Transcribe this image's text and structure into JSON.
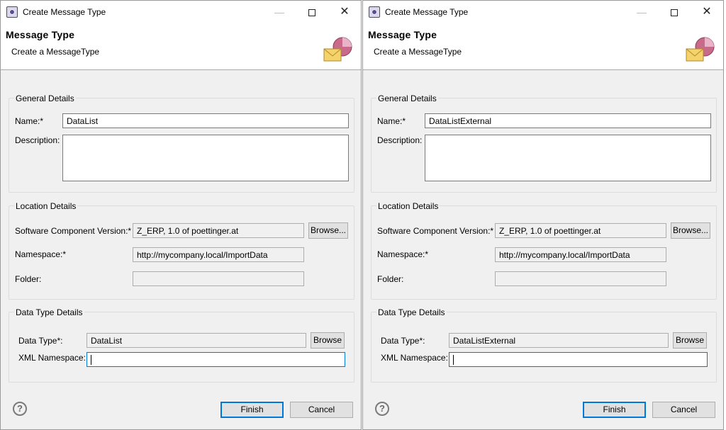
{
  "dialogs": [
    {
      "window_title": "Create Message Type",
      "banner_title": "Message Type",
      "banner_subtitle": "Create a MessageType",
      "general": {
        "legend": "General Details",
        "name_label": "Name:*",
        "name_value": "DataList",
        "description_label": "Description:",
        "description_value": ""
      },
      "location": {
        "legend": "Location Details",
        "swcv_label": "Software Component Version:*",
        "swcv_value": "Z_ERP, 1.0 of poettinger.at",
        "browse_label": "Browse...",
        "namespace_label": "Namespace:*",
        "namespace_value": "http://mycompany.local/ImportData",
        "folder_label": "Folder:",
        "folder_value": ""
      },
      "datatype": {
        "legend": "Data Type Details",
        "datatype_label": "Data Type*:",
        "datatype_value": "DataList",
        "browse_label": "Browse",
        "xmlns_label": "XML Namespace:",
        "xmlns_value": ""
      },
      "footer": {
        "help_glyph": "?",
        "finish_label": "Finish",
        "cancel_label": "Cancel"
      }
    },
    {
      "window_title": "Create Message Type",
      "banner_title": "Message Type",
      "banner_subtitle": "Create a MessageType",
      "general": {
        "legend": "General Details",
        "name_label": "Name:*",
        "name_value": "DataListExternal",
        "description_label": "Description:",
        "description_value": ""
      },
      "location": {
        "legend": "Location Details",
        "swcv_label": "Software Component Version:*",
        "swcv_value": "Z_ERP, 1.0 of poettinger.at",
        "browse_label": "Browse...",
        "namespace_label": "Namespace:*",
        "namespace_value": "http://mycompany.local/ImportData",
        "folder_label": "Folder:",
        "folder_value": ""
      },
      "datatype": {
        "legend": "Data Type Details",
        "datatype_label": "Data Type*:",
        "datatype_value": "DataListExternal",
        "browse_label": "Browse",
        "xmlns_label": "XML Namespace:",
        "xmlns_value": ""
      },
      "footer": {
        "help_glyph": "?",
        "finish_label": "Finish",
        "cancel_label": "Cancel"
      }
    }
  ],
  "window_controls": {
    "minimize_glyph": "—",
    "close_glyph": "✕"
  },
  "icons": {
    "app": "app-gear-icon",
    "wizard": "message-envelope-icon"
  },
  "colors": {
    "focus_border": "#0078d7",
    "dialog_bg": "#f0f0f0",
    "banner_bg": "#ffffff"
  }
}
